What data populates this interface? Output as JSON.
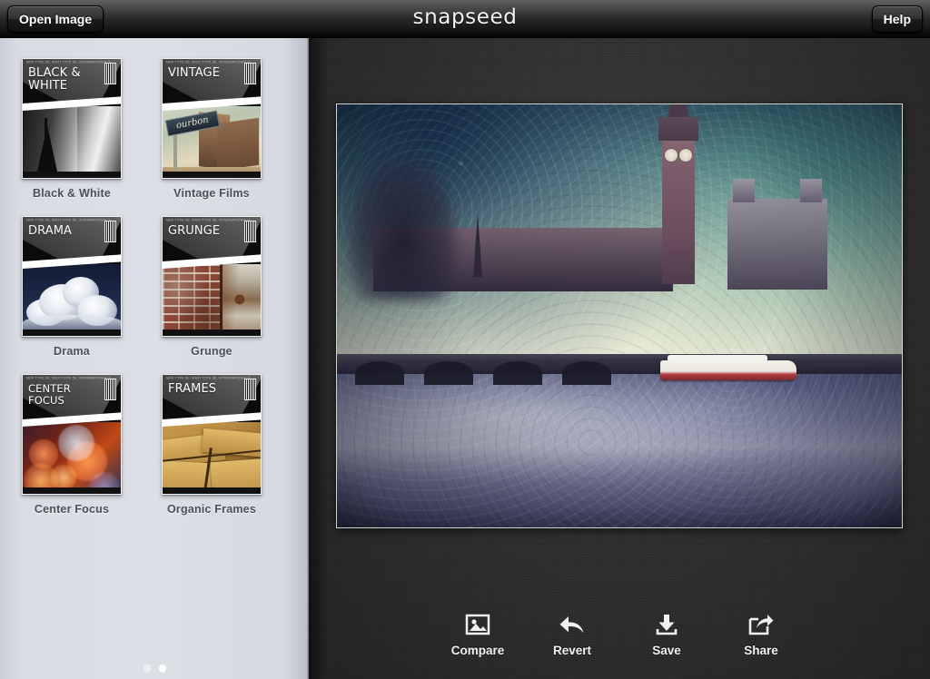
{
  "app": {
    "title": "snapseed",
    "wordmark": "snapseed"
  },
  "topbar": {
    "open_image_label": "Open Image",
    "help_label": "Help"
  },
  "sidebar": {
    "background_color": "#dcdfe5",
    "page_dots": {
      "count": 2,
      "active_index": 1
    },
    "filters": [
      {
        "name": "Black & White",
        "cover_title": "BLACK &\nWHITE",
        "microtype": "MINI TYPE 5E, MAXI TYPE 5E, INTERNATIONAL 5",
        "art": "eiffel-tower-grayscale"
      },
      {
        "name": "Vintage Films",
        "cover_title": "VINTAGE",
        "microtype": "MINI TYPE 5E, MAXI TYPE 5E, INTERNATIONAL 5",
        "art": "retro-street-sign",
        "sign_text": "ourbon"
      },
      {
        "name": "Drama",
        "cover_title": "DRAMA",
        "microtype": "MINI TYPE 5E, MAXI TYPE 5E, INTERNATIONAL 5",
        "art": "clouds-dark-sky"
      },
      {
        "name": "Grunge",
        "cover_title": "GRUNGE",
        "microtype": "MINI TYPE 5E, MAXI TYPE 5E, INTERNATIONAL 5",
        "art": "brick-wall-rust"
      },
      {
        "name": "Center Focus",
        "cover_title": "CENTER\nFOCUS",
        "microtype": "MINI TYPE 5E, MAXI TYPE 5E, INTERNATIONAL 5",
        "art": "bokeh-lights"
      },
      {
        "name": "Organic Frames",
        "cover_title": "FRAMES",
        "microtype": "MINI TYPE 5E, MAXI TYPE 5E, INTERNATIONAL 5",
        "art": "torn-aged-paper"
      }
    ]
  },
  "canvas": {
    "photo_alt": "Big Ben and Houses of Parliament over the River Thames, vintage grunge filter applied",
    "background_color": "#2e2e2e"
  },
  "toolbar": {
    "items": [
      {
        "label": "Compare",
        "icon": "image-icon"
      },
      {
        "label": "Revert",
        "icon": "undo-arrow-icon"
      },
      {
        "label": "Save",
        "icon": "download-icon"
      },
      {
        "label": "Share",
        "icon": "share-icon"
      }
    ]
  }
}
